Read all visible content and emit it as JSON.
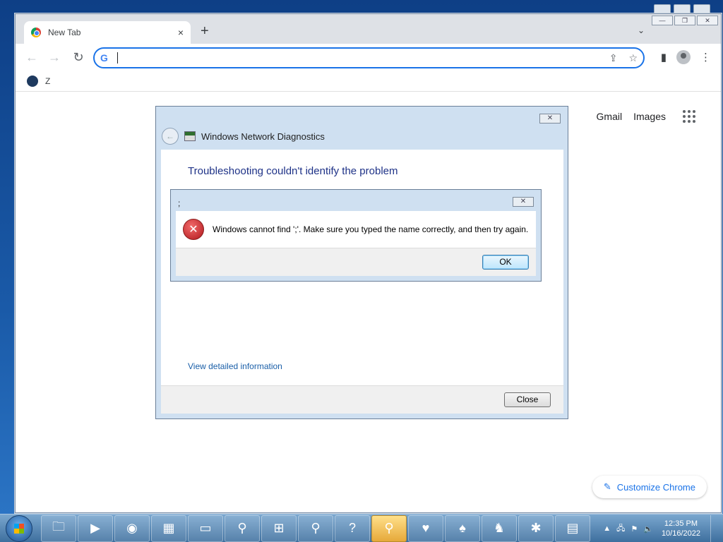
{
  "browser": {
    "tab_title": "New Tab",
    "tab_close": "×",
    "new_tab": "+",
    "tab_search": "⌄",
    "window_controls": [
      "—",
      "❐",
      "✕"
    ],
    "nav": {
      "back": "←",
      "forward": "→",
      "reload": "↻"
    },
    "omnibox": {
      "g_icon": "G",
      "value": "",
      "share_icon": "⇪",
      "star_icon": "☆"
    },
    "toolbar_icons": {
      "side_panel": "▮",
      "menu": "⋮"
    },
    "bookmark_label": "Z",
    "ntp": {
      "gmail": "Gmail",
      "images": "Images"
    },
    "customize_icon": "✎",
    "customize_label": "Customize Chrome"
  },
  "diagnostics": {
    "close_glyph": "✕",
    "back_glyph": "←",
    "title": "Windows Network Diagnostics",
    "heading": "Troubleshooting couldn't identify the problem",
    "link": "View detailed information",
    "close_button": "Close"
  },
  "error_dialog": {
    "title": ";",
    "close_glyph": "✕",
    "icon_glyph": "✕",
    "message": "Windows cannot find ';'. Make sure you typed the name correctly, and then try again.",
    "ok_button": "OK"
  },
  "taskbar": {
    "items": [
      {
        "name": "explorer",
        "glyph": "🗀"
      },
      {
        "name": "media-player",
        "glyph": "▶"
      },
      {
        "name": "chrome",
        "glyph": "◉"
      },
      {
        "name": "control-panel",
        "glyph": "▦"
      },
      {
        "name": "remote-desktop",
        "glyph": "▭"
      },
      {
        "name": "search",
        "glyph": "⚲"
      },
      {
        "name": "windows-update",
        "glyph": "⊞"
      },
      {
        "name": "search-2",
        "glyph": "⚲"
      },
      {
        "name": "help",
        "glyph": "?"
      },
      {
        "name": "network-diagnostics",
        "glyph": "⚲"
      },
      {
        "name": "hearts",
        "glyph": "♥"
      },
      {
        "name": "solitaire",
        "glyph": "♠"
      },
      {
        "name": "chess",
        "glyph": "♞"
      },
      {
        "name": "spider-solitaire",
        "glyph": "✱"
      },
      {
        "name": "task-manager",
        "glyph": "▤"
      }
    ],
    "tray_up": "▲",
    "tray_network": "🖧",
    "tray_flag": "⚑",
    "tray_volume": "🔈",
    "time": "12:35 PM",
    "date": "10/16/2022"
  }
}
